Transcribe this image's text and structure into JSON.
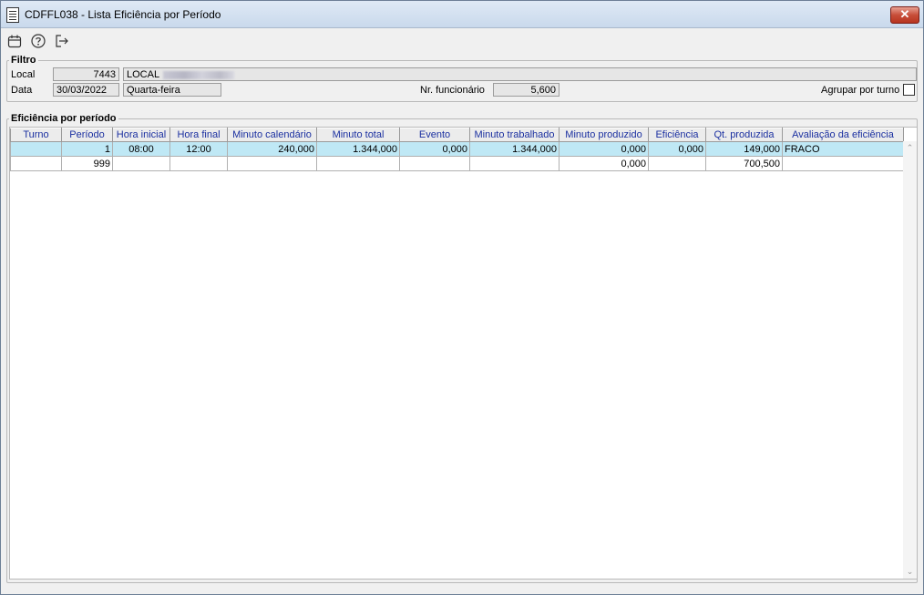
{
  "window": {
    "title": "CDFFL038 - Lista Eficiência por Período",
    "close_glyph": "✕"
  },
  "toolbar": {
    "icons": [
      "calendar-icon",
      "help-icon",
      "exit-icon"
    ]
  },
  "filtro": {
    "legend": "Filtro",
    "local_label": "Local",
    "local_code": "7443",
    "local_name": "LOCAL",
    "data_label": "Data",
    "data_value": "30/03/2022",
    "weekday": "Quarta-feira",
    "nr_funcionario_label": "Nr. funcionário",
    "nr_funcionario_value": "5,600",
    "agrupar_label": "Agrupar por turno",
    "agrupar_checked": false
  },
  "grid": {
    "legend": "Eficiência por período",
    "columns": [
      "Turno",
      "Período",
      "Hora inicial",
      "Hora final",
      "Minuto calendário",
      "Minuto total",
      "Evento",
      "Minuto trabalhado",
      "Minuto produzido",
      "Eficiência",
      "Qt. produzida",
      "Avaliação da eficiência"
    ],
    "rows": [
      [
        "",
        "1",
        "08:00",
        "12:00",
        "240,000",
        "1.344,000",
        "0,000",
        "1.344,000",
        "0,000",
        "0,000",
        "149,000",
        "FRACO"
      ],
      [
        "",
        "999",
        "",
        "",
        "",
        "",
        "",
        "",
        "0,000",
        "",
        "700,500",
        ""
      ]
    ]
  },
  "colors": {
    "header_text": "#1a2fa0",
    "selected_row": "#bfe8f5"
  }
}
